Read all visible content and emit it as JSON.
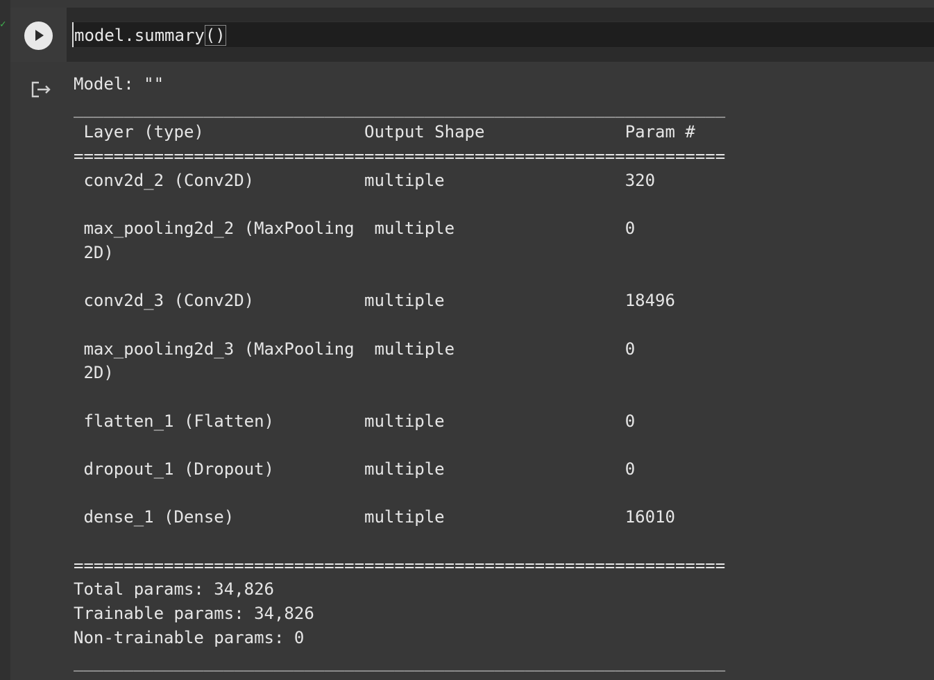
{
  "cell": {
    "code": {
      "prefix": "model.summary",
      "parens": "()"
    }
  },
  "output": {
    "lines": [
      "Model: \"\"",
      "_________________________________________________________________",
      " Layer (type)                Output Shape              Param #",
      "=================================================================",
      " conv2d_2 (Conv2D)           multiple                  320",
      "",
      " max_pooling2d_2 (MaxPooling  multiple                 0",
      " 2D)",
      "",
      " conv2d_3 (Conv2D)           multiple                  18496",
      "",
      " max_pooling2d_3 (MaxPooling  multiple                 0",
      " 2D)",
      "",
      " flatten_1 (Flatten)         multiple                  0",
      "",
      " dropout_1 (Dropout)         multiple                  0",
      "",
      " dense_1 (Dense)             multiple                  16010",
      "",
      "=================================================================",
      "Total params: 34,826",
      "Trainable params: 34,826",
      "Non-trainable params: 0",
      "_________________________________________________________________"
    ]
  },
  "icons": {
    "run": "play-icon",
    "output": "output-arrow-icon",
    "status": "checkmark-icon"
  },
  "colors": {
    "background": "#383838",
    "editor_background": "#1e1e1e",
    "text": "#e6e6e6",
    "status_ok": "#3fb950"
  }
}
